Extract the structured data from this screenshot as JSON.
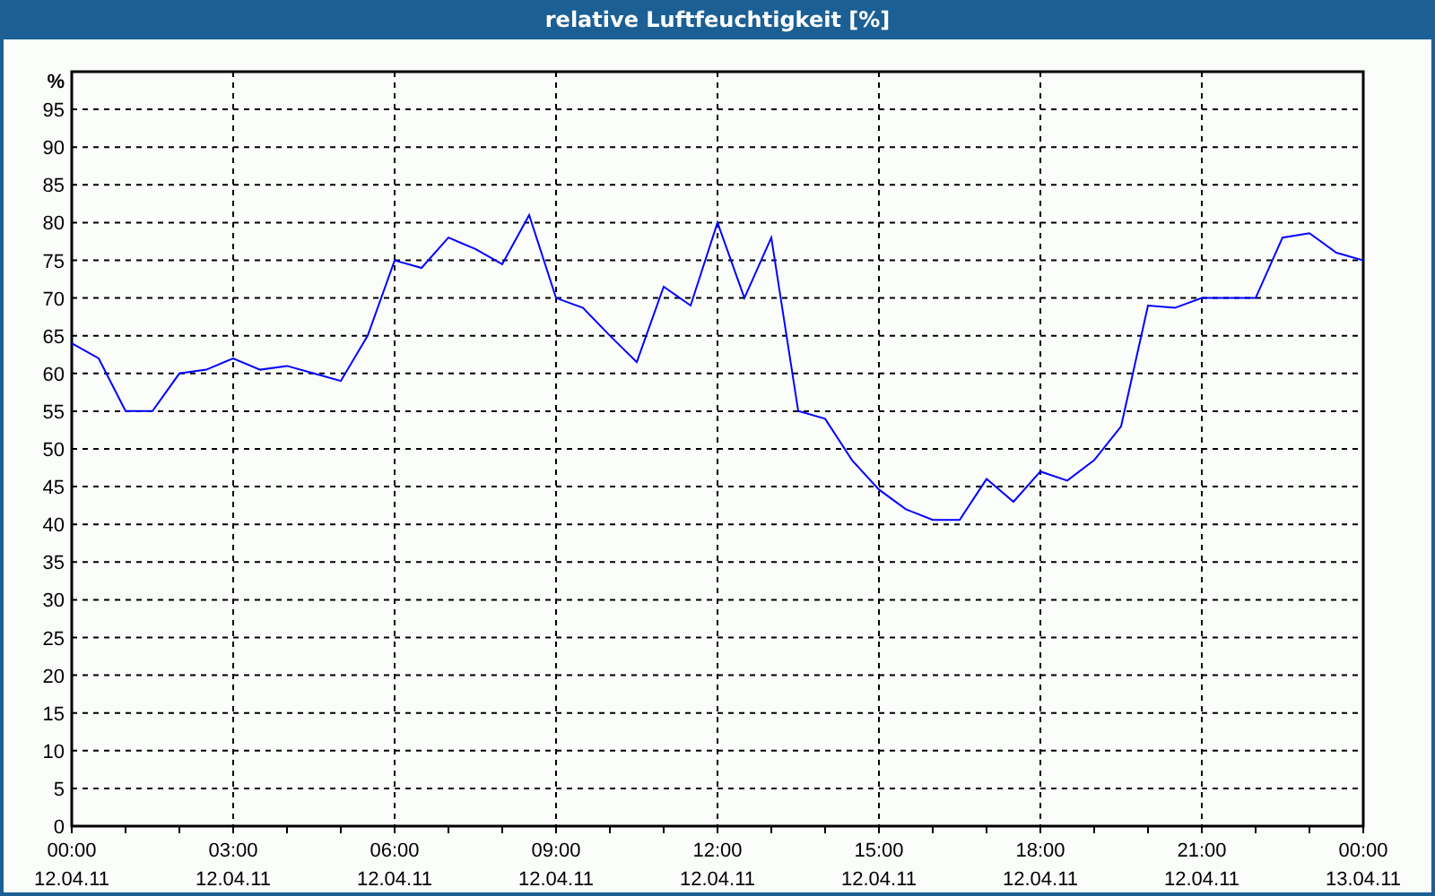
{
  "chart_data": {
    "type": "line",
    "title": "relative Luftfeuchtigkeit [%]",
    "ylabel": "%",
    "categories": [
      "00:00\n12.04.11",
      null,
      null,
      null,
      null,
      null,
      "03:00\n12.04.11",
      null,
      null,
      null,
      null,
      null,
      "06:00\n12.04.11",
      null,
      null,
      null,
      null,
      null,
      "09:00\n12.04.11",
      null,
      null,
      null,
      null,
      null,
      "12:00\n12.04.11",
      null,
      null,
      null,
      null,
      null,
      "15:00\n12.04.11",
      null,
      null,
      null,
      null,
      null,
      "18:00\n12.04.11",
      null,
      null,
      null,
      null,
      null,
      "21:00\n12.04.11",
      null,
      null,
      null,
      null,
      null,
      "00:00\n13.04.11"
    ],
    "values": [
      64,
      62,
      55,
      55,
      60,
      60.5,
      62,
      60.5,
      61,
      60,
      59,
      65,
      75,
      74,
      78,
      76.5,
      74.5,
      81,
      70,
      68.7,
      65,
      61.5,
      71.5,
      69,
      80,
      70,
      78,
      55,
      54,
      48.5,
      44.6,
      42,
      40.6,
      40.6,
      46,
      43,
      47,
      45.8,
      48.5,
      53,
      69,
      68.7,
      70,
      70,
      70,
      78,
      78.6,
      76,
      75
    ],
    "ylim": [
      0,
      100
    ],
    "grid": true,
    "yticks": [
      0,
      5,
      10,
      15,
      20,
      25,
      30,
      35,
      40,
      45,
      50,
      55,
      60,
      65,
      70,
      75,
      80,
      85,
      90,
      95
    ]
  }
}
